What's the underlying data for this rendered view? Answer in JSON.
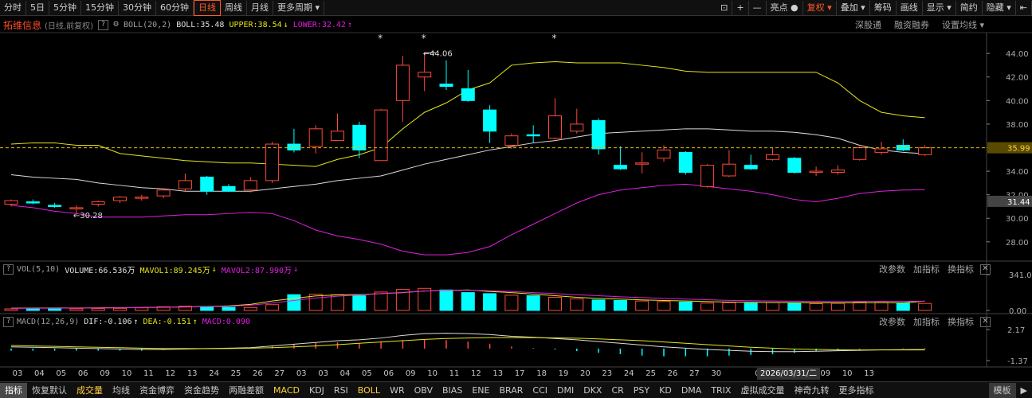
{
  "toolbar": {
    "periods": [
      "分时",
      "5日",
      "5分钟",
      "15分钟",
      "30分钟",
      "60分钟",
      "日线",
      "周线",
      "月线",
      "更多周期"
    ],
    "active_period": "日线",
    "right_items": [
      "亮点",
      "复权",
      "叠加",
      "筹码",
      "画线",
      "显示",
      "简约",
      "隐藏"
    ]
  },
  "info": {
    "stock_name": "拓维信息",
    "period_note": "(日线,前复权)",
    "indicator": "BOLL(20,2)",
    "boll_label": "BOLL:35.48",
    "upper_label": "UPPER:38.54",
    "lower_label": "LOWER:32.42",
    "links": [
      "深股通",
      "融资融券",
      "设置均线"
    ]
  },
  "vol_panel": {
    "indicator": "VOL(5,10)",
    "volume_label": "VOLUME:66.536万",
    "mavol1_label": "MAVOL1:89.245万",
    "mavol2_label": "MAVOL2:87.990万",
    "buttons": [
      "改参数",
      "加指标",
      "换指标"
    ],
    "axis_top": "341.00",
    "axis_bottom": "0.00"
  },
  "macd_panel": {
    "indicator": "MACD(12,26,9)",
    "dif_label": "DIF:-0.106",
    "dea_label": "DEA:-0.151",
    "macd_label": "MACD:0.090",
    "buttons": [
      "改参数",
      "加指标",
      "换指标"
    ],
    "axis_top": "2.17",
    "axis_bottom": "-1.37"
  },
  "annotations": {
    "max_label": "44.06",
    "min_label": "30.28",
    "current_price": "35.99",
    "lower_price": "31.44"
  },
  "date_axis": {
    "labels": [
      "03",
      "04",
      "05",
      "06",
      "09",
      "10",
      "11",
      "12",
      "13",
      "24",
      "25",
      "26",
      "27",
      "03",
      "03",
      "04",
      "05",
      "06",
      "09",
      "10",
      "11",
      "12",
      "13",
      "17",
      "18",
      "19",
      "20",
      "23",
      "24",
      "25",
      "26",
      "27",
      "30",
      "02",
      "03",
      "07",
      "08",
      "09",
      "10",
      "13"
    ],
    "highlight": "2026/03/31/二"
  },
  "tabs": {
    "items": [
      "指标",
      "恢复默认",
      "成交量",
      "均线",
      "资金博弈",
      "资金趋势",
      "两融差额",
      "MACD",
      "KDJ",
      "RSI",
      "BOLL",
      "WR",
      "OBV",
      "BIAS",
      "ENE",
      "BRAR",
      "CCI",
      "DMI",
      "DKX",
      "CR",
      "PSY",
      "KD",
      "DMA",
      "TRIX",
      "虚拟成交量",
      "神奇九转",
      "更多指标"
    ],
    "selected": "指标",
    "highlighted": [
      "成交量",
      "MACD",
      "BOLL"
    ],
    "right": "模板"
  },
  "colors": {
    "up": "#ff4a3a",
    "down": "#00ffff",
    "upper": "#e6e619",
    "mid": "#dcdcdc",
    "lower": "#e020e0",
    "dif": "#dcdcdc",
    "dea": "#e6e619",
    "accent": "#ff5a2a"
  },
  "chart_data": {
    "type": "candlestick",
    "price_axis": {
      "ticks": [
        "44.00",
        "42.00",
        "40.00",
        "38.00",
        "36.00",
        "34.00",
        "32.00",
        "30.00",
        "28.00"
      ],
      "range": [
        26.5,
        45.7
      ]
    },
    "candles": [
      {
        "o": 31.2,
        "h": 31.6,
        "l": 31.0,
        "c": 31.5
      },
      {
        "o": 31.4,
        "h": 31.6,
        "l": 31.2,
        "c": 31.3
      },
      {
        "o": 31.1,
        "h": 31.3,
        "l": 30.9,
        "c": 31.0
      },
      {
        "o": 30.9,
        "h": 31.1,
        "l": 30.3,
        "c": 30.9
      },
      {
        "o": 31.2,
        "h": 31.5,
        "l": 31.0,
        "c": 31.4
      },
      {
        "o": 31.5,
        "h": 31.9,
        "l": 31.3,
        "c": 31.8
      },
      {
        "o": 31.7,
        "h": 32.0,
        "l": 31.5,
        "c": 31.8
      },
      {
        "o": 31.9,
        "h": 32.5,
        "l": 31.7,
        "c": 32.4
      },
      {
        "o": 32.5,
        "h": 33.8,
        "l": 32.3,
        "c": 33.2
      },
      {
        "o": 33.5,
        "h": 33.6,
        "l": 32.0,
        "c": 32.3
      },
      {
        "o": 32.7,
        "h": 32.9,
        "l": 32.3,
        "c": 32.3
      },
      {
        "o": 32.4,
        "h": 33.5,
        "l": 32.2,
        "c": 33.2
      },
      {
        "o": 33.2,
        "h": 36.5,
        "l": 33.0,
        "c": 36.3
      },
      {
        "o": 36.3,
        "h": 37.6,
        "l": 35.6,
        "c": 35.8
      },
      {
        "o": 36.1,
        "h": 37.9,
        "l": 35.5,
        "c": 37.6
      },
      {
        "o": 36.6,
        "h": 38.9,
        "l": 36.6,
        "c": 37.4
      },
      {
        "o": 37.9,
        "h": 38.2,
        "l": 35.1,
        "c": 35.8
      },
      {
        "o": 34.9,
        "h": 39.3,
        "l": 34.9,
        "c": 39.2
      },
      {
        "o": 40.0,
        "h": 43.8,
        "l": 38.2,
        "c": 43.0
      },
      {
        "o": 42.0,
        "h": 44.06,
        "l": 40.8,
        "c": 42.4
      },
      {
        "o": 41.4,
        "h": 43.4,
        "l": 40.9,
        "c": 41.2
      },
      {
        "o": 41.0,
        "h": 42.6,
        "l": 39.9,
        "c": 40.0
      },
      {
        "o": 39.2,
        "h": 39.6,
        "l": 36.4,
        "c": 37.4
      },
      {
        "o": 36.2,
        "h": 37.2,
        "l": 35.9,
        "c": 37.0
      },
      {
        "o": 37.1,
        "h": 37.9,
        "l": 36.4,
        "c": 37.0
      },
      {
        "o": 36.8,
        "h": 40.2,
        "l": 36.7,
        "c": 38.7
      },
      {
        "o": 37.4,
        "h": 39.3,
        "l": 37.2,
        "c": 38.0
      },
      {
        "o": 38.3,
        "h": 38.5,
        "l": 35.4,
        "c": 35.9
      },
      {
        "o": 34.5,
        "h": 36.1,
        "l": 34.1,
        "c": 34.2
      },
      {
        "o": 34.7,
        "h": 35.6,
        "l": 33.8,
        "c": 34.7
      },
      {
        "o": 35.1,
        "h": 36.2,
        "l": 34.8,
        "c": 35.8
      },
      {
        "o": 35.6,
        "h": 35.7,
        "l": 33.7,
        "c": 33.9
      },
      {
        "o": 32.7,
        "h": 34.6,
        "l": 32.6,
        "c": 34.5
      },
      {
        "o": 33.6,
        "h": 35.8,
        "l": 33.5,
        "c": 34.6
      },
      {
        "o": 34.5,
        "h": 35.4,
        "l": 34.1,
        "c": 34.2
      },
      {
        "o": 35.0,
        "h": 36.0,
        "l": 34.9,
        "c": 35.4
      },
      {
        "o": 35.1,
        "h": 35.2,
        "l": 33.8,
        "c": 33.9
      },
      {
        "o": 33.9,
        "h": 34.4,
        "l": 33.6,
        "c": 34.0
      },
      {
        "o": 33.9,
        "h": 34.5,
        "l": 33.7,
        "c": 34.1
      },
      {
        "o": 35.0,
        "h": 36.1,
        "l": 34.9,
        "c": 36.0
      },
      {
        "o": 35.6,
        "h": 36.5,
        "l": 35.4,
        "c": 35.9
      },
      {
        "o": 36.2,
        "h": 36.7,
        "l": 35.7,
        "c": 35.8
      },
      {
        "o": 35.4,
        "h": 36.2,
        "l": 35.3,
        "c": 35.99
      }
    ],
    "upper": [
      36.3,
      36.4,
      36.4,
      36.2,
      36.2,
      35.5,
      35.3,
      35.1,
      34.9,
      34.8,
      34.7,
      34.7,
      34.6,
      34.5,
      34.4,
      35.0,
      35.4,
      36.0,
      37.6,
      39.0,
      39.8,
      40.9,
      41.5,
      43.0,
      43.2,
      43.3,
      43.2,
      43.2,
      43.2,
      43.0,
      42.8,
      42.5,
      42.4,
      42.4,
      42.4,
      42.4,
      42.4,
      42.4,
      41.5,
      40.0,
      39.0,
      38.7,
      38.54
    ],
    "mid": [
      33.7,
      33.5,
      33.4,
      33.3,
      33.0,
      32.8,
      32.6,
      32.5,
      32.3,
      32.3,
      32.3,
      32.3,
      32.5,
      32.7,
      32.9,
      33.2,
      33.4,
      33.6,
      34.1,
      34.6,
      35.0,
      35.4,
      35.8,
      36.1,
      36.4,
      36.6,
      36.9,
      37.2,
      37.3,
      37.4,
      37.5,
      37.6,
      37.6,
      37.5,
      37.4,
      37.4,
      37.3,
      37.1,
      36.8,
      36.2,
      35.8,
      35.6,
      35.48
    ],
    "lower": [
      31.1,
      30.9,
      30.6,
      30.4,
      30.1,
      30.1,
      30.1,
      30.2,
      30.3,
      30.3,
      30.4,
      30.5,
      30.4,
      29.8,
      29.0,
      28.5,
      28.2,
      27.8,
      27.2,
      26.9,
      26.9,
      27.1,
      27.6,
      28.6,
      29.5,
      30.4,
      31.3,
      32.0,
      32.4,
      32.6,
      32.8,
      32.9,
      32.7,
      32.5,
      32.3,
      32.0,
      31.6,
      31.4,
      31.7,
      32.1,
      32.3,
      32.4,
      32.42
    ],
    "volume": [
      15,
      18,
      17,
      16,
      18,
      20,
      25,
      35,
      40,
      38,
      30,
      28,
      55,
      150,
      155,
      150,
      140,
      175,
      200,
      210,
      195,
      170,
      160,
      145,
      140,
      125,
      110,
      100,
      95,
      90,
      85,
      80,
      70,
      75,
      70,
      75,
      70,
      65,
      68,
      78,
      75,
      70,
      66.5
    ],
    "mavol1": [
      22,
      23,
      24,
      24,
      25,
      26,
      28,
      30,
      34,
      38,
      44,
      58,
      90,
      115,
      138,
      148,
      152,
      160,
      170,
      185,
      190,
      195,
      180,
      170,
      155,
      140,
      125,
      115,
      108,
      100,
      95,
      90,
      85,
      80,
      78,
      76,
      74,
      73,
      72,
      73,
      74,
      72,
      89
    ],
    "mavol2": [
      20,
      21,
      22,
      23,
      24,
      25,
      27,
      29,
      32,
      36,
      40,
      50,
      70,
      95,
      118,
      135,
      148,
      160,
      172,
      185,
      190,
      192,
      188,
      180,
      170,
      160,
      150,
      140,
      130,
      122,
      115,
      108,
      102,
      96,
      92,
      90,
      88,
      86,
      85,
      86,
      87,
      87,
      88
    ],
    "dif": [
      0.2,
      0.15,
      0.1,
      0.05,
      0.0,
      -0.05,
      -0.1,
      -0.1,
      -0.05,
      0.0,
      0.05,
      0.1,
      0.3,
      0.5,
      0.7,
      0.9,
      1.0,
      1.2,
      1.5,
      1.7,
      1.75,
      1.7,
      1.6,
      1.4,
      1.3,
      1.15,
      1.0,
      0.8,
      0.6,
      0.4,
      0.2,
      0.05,
      -0.1,
      -0.2,
      -0.3,
      -0.35,
      -0.35,
      -0.3,
      -0.25,
      -0.2,
      -0.15,
      -0.12,
      -0.106
    ],
    "dea": [
      0.35,
      0.3,
      0.25,
      0.2,
      0.15,
      0.1,
      0.05,
      0.0,
      0.0,
      0.0,
      0.0,
      0.05,
      0.1,
      0.2,
      0.3,
      0.45,
      0.6,
      0.75,
      0.9,
      1.05,
      1.15,
      1.2,
      1.25,
      1.25,
      1.25,
      1.22,
      1.18,
      1.1,
      1.0,
      0.9,
      0.75,
      0.6,
      0.45,
      0.3,
      0.15,
      0.05,
      -0.05,
      -0.1,
      -0.14,
      -0.16,
      -0.16,
      -0.155,
      -0.151
    ],
    "x_range_days": 43
  }
}
